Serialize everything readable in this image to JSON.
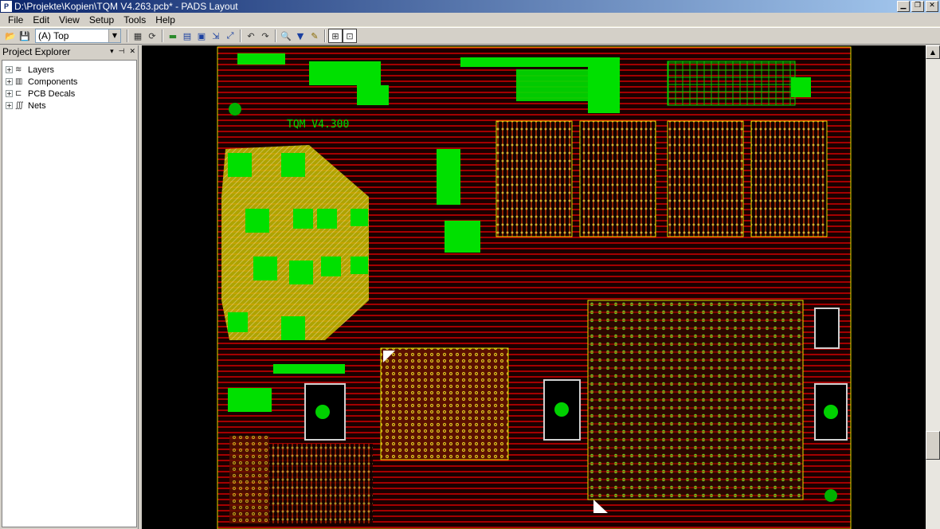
{
  "window": {
    "title": "D:\\Projekte\\Kopien\\TQM V4.263.pcb* - PADS Layout",
    "app_icon": "P",
    "buttons": [
      "minimize-icon",
      "maximize-icon",
      "close-icon"
    ]
  },
  "menu": [
    "File",
    "Edit",
    "View",
    "Setup",
    "Tools",
    "Help"
  ],
  "toolbar": {
    "layer_value": "(A) Top"
  },
  "explorer": {
    "title": "Project Explorer",
    "items": [
      {
        "label": "Layers",
        "icon": "layers-icon"
      },
      {
        "label": "Components",
        "icon": "component-icon"
      },
      {
        "label": "PCB Decals",
        "icon": "decal-icon"
      },
      {
        "label": "Nets",
        "icon": "nets-icon"
      }
    ]
  },
  "board": {
    "label": "TQM V4.300",
    "colors": {
      "background": "#000000",
      "copper_top": "#00ff00",
      "copper_bottom": "#ff0000",
      "silk": "#ffff00"
    }
  }
}
